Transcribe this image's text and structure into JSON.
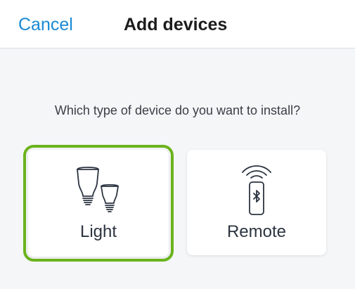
{
  "header": {
    "cancel_label": "Cancel",
    "title": "Add devices"
  },
  "prompt": "Which type of device do you want to install?",
  "devices": [
    {
      "label": "Light",
      "icon": "light-bulbs-icon",
      "selected": true
    },
    {
      "label": "Remote",
      "icon": "bluetooth-remote-icon",
      "selected": false
    }
  ],
  "colors": {
    "accent": "#1a8ad4",
    "selected_outline": "#6bb31c",
    "background": "#f4f6f8"
  }
}
